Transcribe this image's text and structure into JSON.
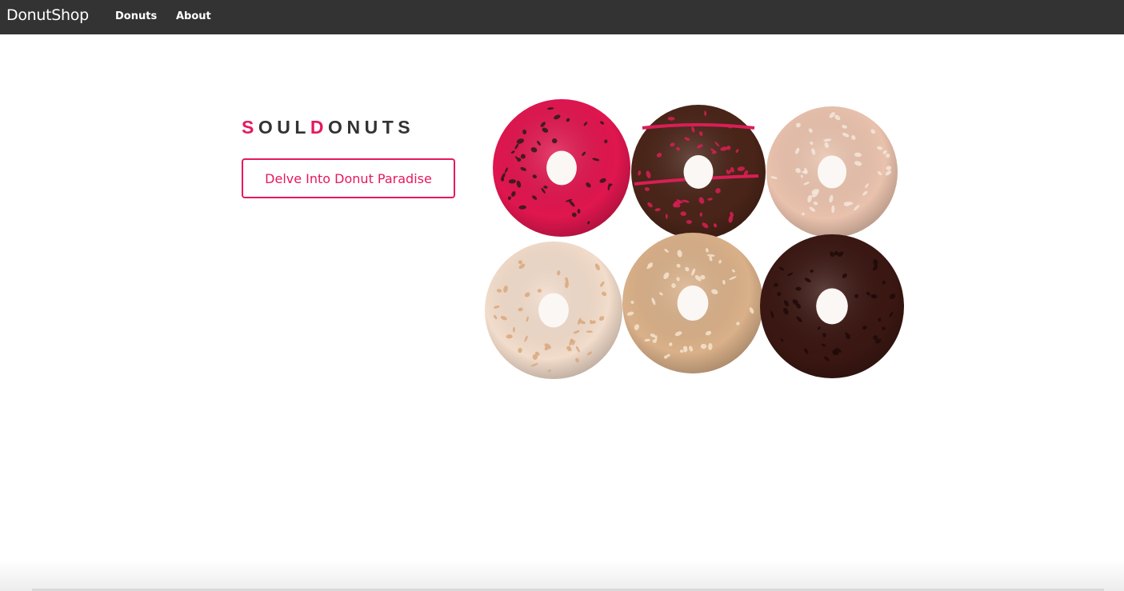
{
  "navbar": {
    "brand": "DonutShop",
    "links": [
      {
        "label": "Donuts"
      },
      {
        "label": "About"
      }
    ],
    "background": "#333333"
  },
  "hero": {
    "logo": {
      "letters": [
        {
          "char": "S",
          "accent": true
        },
        {
          "char": "O",
          "accent": false
        },
        {
          "char": "U",
          "accent": false
        },
        {
          "char": "L",
          "accent": false
        },
        {
          "char": "D",
          "accent": true
        },
        {
          "char": "O",
          "accent": false
        },
        {
          "char": "N",
          "accent": false
        },
        {
          "char": "U",
          "accent": false
        },
        {
          "char": "T",
          "accent": false
        },
        {
          "char": "S",
          "accent": false
        }
      ],
      "accent_color": "#e6195d",
      "text_color": "#333333"
    },
    "cta_label": "Delve Into Donut Paradise",
    "image": {
      "description_icon": "donuts-photo",
      "donuts": [
        {
          "glaze": "#e0164f",
          "topping": "#2a1a1a"
        },
        {
          "glaze": "#4a2418",
          "topping": "#d81f55"
        },
        {
          "glaze": "#e9c2ad",
          "topping": "#f3e6dc"
        },
        {
          "glaze": "#f2dccb",
          "topping": "#d8a87c"
        },
        {
          "glaze": "#d9b089",
          "topping": "#f4e3cc"
        },
        {
          "glaze": "#3b1712",
          "topping": "#1f0a08"
        }
      ]
    }
  }
}
